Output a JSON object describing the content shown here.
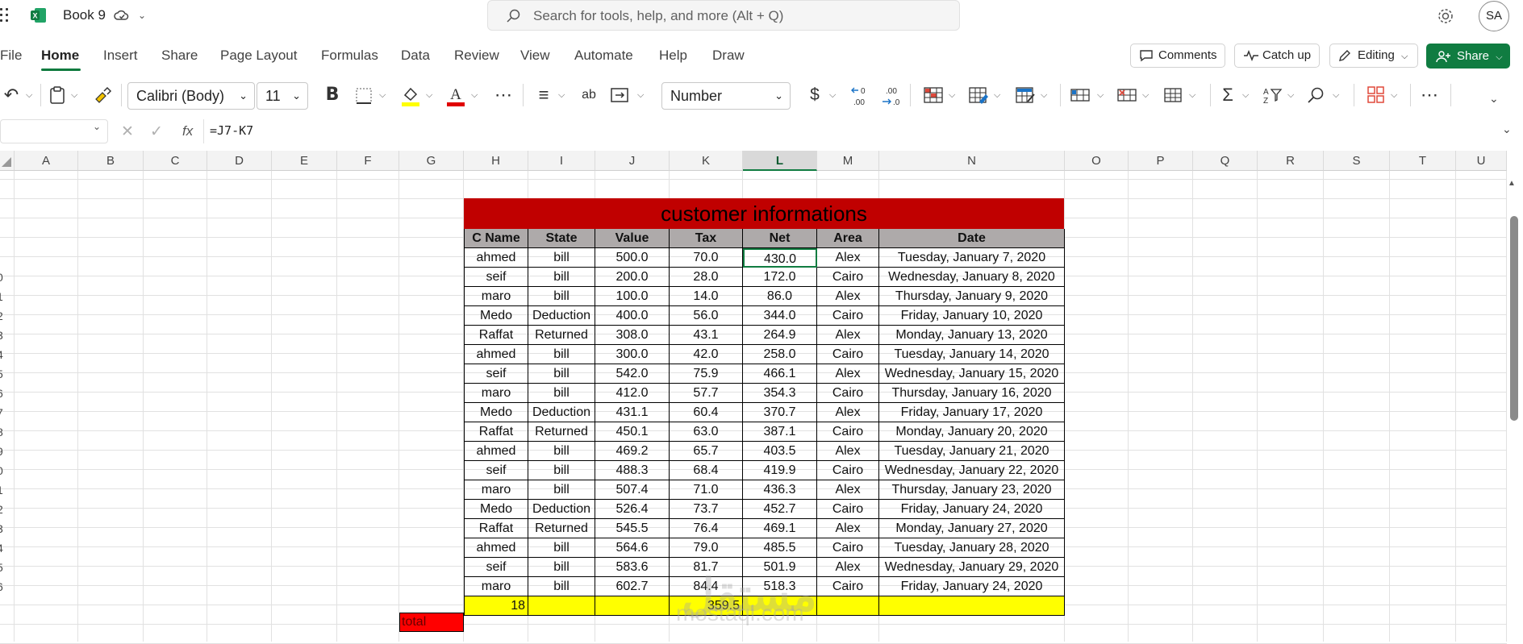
{
  "app": {
    "doc_title": "Book 9",
    "avatar": "SA"
  },
  "search": {
    "placeholder": "Search for tools, help, and more (Alt + Q)"
  },
  "menu": {
    "tabs": [
      "File",
      "Home",
      "Insert",
      "Share",
      "Page Layout",
      "Formulas",
      "Data",
      "Review",
      "View",
      "Automate",
      "Help",
      "Draw"
    ],
    "active": "Home"
  },
  "actions": {
    "comments": "Comments",
    "catch_up": "Catch up",
    "editing": "Editing",
    "share": "Share"
  },
  "ribbon": {
    "font_name": "Calibri (Body)",
    "font_size": "11",
    "number_format": "Number",
    "currency_symbol": "$"
  },
  "formula_bar": {
    "name_box": "",
    "formula": "=J7-K7"
  },
  "grid": {
    "columns": [
      "A",
      "B",
      "C",
      "D",
      "E",
      "F",
      "G",
      "H",
      "I",
      "J",
      "K",
      "L",
      "M",
      "N",
      "O",
      "P",
      "Q",
      "R",
      "S",
      "T",
      "U"
    ],
    "selected_column": "L",
    "row_numbers": [
      "",
      "",
      "",
      "",
      "0",
      "1",
      "2",
      "3",
      "4",
      "5",
      "6",
      "7",
      "8",
      "9",
      "0",
      "1",
      "2",
      "3",
      "4",
      "5",
      "6"
    ]
  },
  "table": {
    "title": "customer informations",
    "headers": [
      "C Name",
      "State",
      "Value",
      "Tax",
      "Net",
      "Area",
      "Date"
    ],
    "rows": [
      [
        "ahmed",
        "bill",
        "500.0",
        "70.0",
        "430.0",
        "Alex",
        "Tuesday, January 7, 2020"
      ],
      [
        "seif",
        "bill",
        "200.0",
        "28.0",
        "172.0",
        "Cairo",
        "Wednesday, January 8, 2020"
      ],
      [
        "maro",
        "bill",
        "100.0",
        "14.0",
        "86.0",
        "Alex",
        "Thursday, January 9, 2020"
      ],
      [
        "Medo",
        "Deduction",
        "400.0",
        "56.0",
        "344.0",
        "Cairo",
        "Friday, January 10, 2020"
      ],
      [
        "Raffat",
        "Returned",
        "308.0",
        "43.1",
        "264.9",
        "Alex",
        "Monday, January 13, 2020"
      ],
      [
        "ahmed",
        "bill",
        "300.0",
        "42.0",
        "258.0",
        "Cairo",
        "Tuesday, January 14, 2020"
      ],
      [
        "seif",
        "bill",
        "542.0",
        "75.9",
        "466.1",
        "Alex",
        "Wednesday, January 15, 2020"
      ],
      [
        "maro",
        "bill",
        "412.0",
        "57.7",
        "354.3",
        "Cairo",
        "Thursday, January 16, 2020"
      ],
      [
        "Medo",
        "Deduction",
        "431.1",
        "60.4",
        "370.7",
        "Alex",
        "Friday, January 17, 2020"
      ],
      [
        "Raffat",
        "Returned",
        "450.1",
        "63.0",
        "387.1",
        "Cairo",
        "Monday, January 20, 2020"
      ],
      [
        "ahmed",
        "bill",
        "469.2",
        "65.7",
        "403.5",
        "Alex",
        "Tuesday, January 21, 2020"
      ],
      [
        "seif",
        "bill",
        "488.3",
        "68.4",
        "419.9",
        "Cairo",
        "Wednesday, January 22, 2020"
      ],
      [
        "maro",
        "bill",
        "507.4",
        "71.0",
        "436.3",
        "Alex",
        "Thursday, January 23, 2020"
      ],
      [
        "Medo",
        "Deduction",
        "526.4",
        "73.7",
        "452.7",
        "Cairo",
        "Friday, January 24, 2020"
      ],
      [
        "Raffat",
        "Returned",
        "545.5",
        "76.4",
        "469.1",
        "Alex",
        "Monday, January 27, 2020"
      ],
      [
        "ahmed",
        "bill",
        "564.6",
        "79.0",
        "485.5",
        "Cairo",
        "Tuesday, January 28, 2020"
      ],
      [
        "seif",
        "bill",
        "583.6",
        "81.7",
        "501.9",
        "Alex",
        "Wednesday, January 29, 2020"
      ],
      [
        "maro",
        "bill",
        "602.7",
        "84.4",
        "518.3",
        "Cairo",
        "Friday, January 24, 2020"
      ]
    ],
    "summary": {
      "count": "18",
      "tax_sum": "359.5"
    },
    "total_label": "total",
    "colors": {
      "title_bg": "#c00000",
      "header_bg": "#aeaaaa",
      "summary_bg": "#ffff00",
      "total_bg": "#ff0000",
      "accent": "#107c41"
    }
  },
  "watermark": {
    "logo": "مستقل",
    "text": "mostaqi.com"
  }
}
